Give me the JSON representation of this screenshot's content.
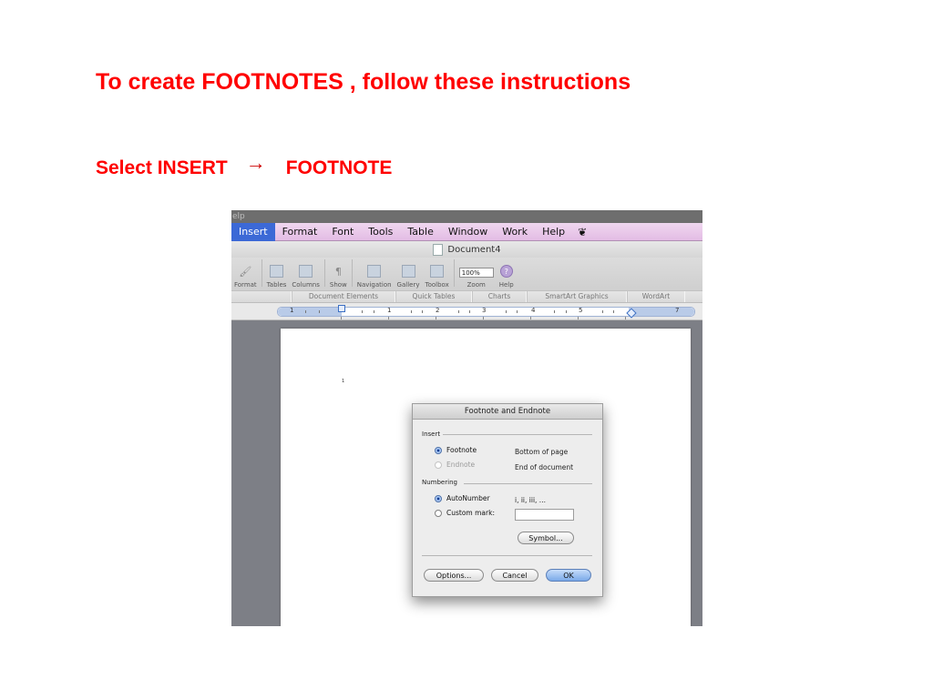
{
  "slide": {
    "heading": "To create FOOTNOTES , follow these instructions",
    "instruction_before": "Select INSERT",
    "arrow": "→",
    "instruction_after": "FOOTNOTE",
    "text_color": "#ff0000"
  },
  "app": {
    "help_strip": "elp",
    "menu": [
      "Insert",
      "Format",
      "Font",
      "Tools",
      "Table",
      "Window",
      "Work",
      "Help"
    ],
    "menu_active": "Insert",
    "script_icon": "script-menu-icon",
    "document_title": "Document4",
    "toolbar": {
      "format": "Format",
      "tables": "Tables",
      "columns": "Columns",
      "show": "Show",
      "navigation": "Navigation",
      "gallery": "Gallery",
      "toolbox": "Toolbox",
      "zoom": "Zoom",
      "zoom_value": "100%",
      "help": "Help"
    },
    "ribbon_tabs": [
      "Document Elements",
      "Quick Tables",
      "Charts",
      "SmartArt Graphics",
      "WordArt"
    ],
    "ruler_numbers": [
      "1",
      "1",
      "2",
      "3",
      "4",
      "5",
      "6",
      "7"
    ],
    "footnote_marker": "1"
  },
  "dialog": {
    "title": "Footnote and Endnote",
    "insert_section": "Insert",
    "footnote_option": "Footnote",
    "footnote_location": "Bottom of page",
    "endnote_option": "Endnote",
    "endnote_location": "End of document",
    "numbering_section": "Numbering",
    "autonumber_option": "AutoNumber",
    "autonumber_format": "i, ii, iii, ...",
    "custom_mark_option": "Custom mark:",
    "custom_mark_value": "",
    "symbol_button": "Symbol...",
    "options_button": "Options...",
    "cancel_button": "Cancel",
    "ok_button": "OK"
  }
}
